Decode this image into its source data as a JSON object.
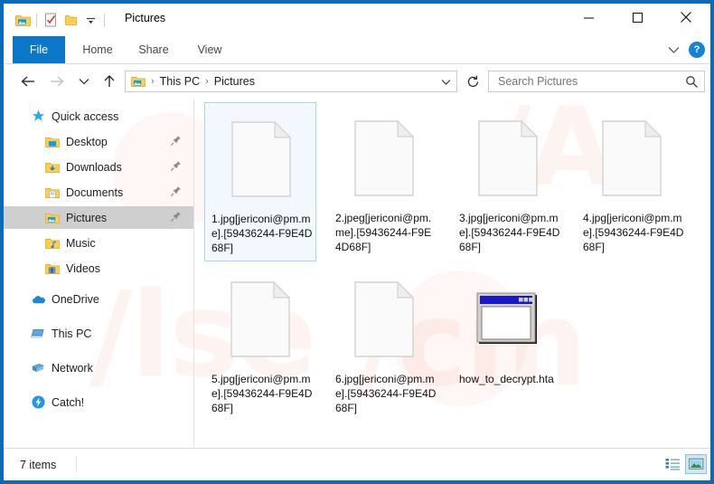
{
  "window": {
    "title": "Pictures",
    "border_color": "#0a6cb8",
    "controls": {
      "minimize": "minimize-icon",
      "maximize": "maximize-icon",
      "close": "close-icon"
    },
    "quick_access_toolbar": [
      {
        "name": "pictures-folder-icon",
        "label": "Pictures"
      },
      {
        "name": "properties-icon",
        "label": "Properties"
      },
      {
        "name": "new-folder-icon",
        "label": "New folder"
      },
      {
        "name": "customize-dropdown-icon",
        "label": "Customize Quick Access Toolbar"
      }
    ]
  },
  "ribbon": {
    "tabs": [
      {
        "label": "File",
        "active": true
      },
      {
        "label": "Home",
        "active": false
      },
      {
        "label": "Share",
        "active": false
      },
      {
        "label": "View",
        "active": false
      }
    ],
    "file_tab_color": "#0c77c8",
    "expand_label": "∨",
    "help_label": "?"
  },
  "address_bar": {
    "back_label": "←",
    "forward_label": "→",
    "recent_label": "∨",
    "up_label": "↑",
    "breadcrumbs": [
      "This PC",
      "Pictures"
    ],
    "separator": "›",
    "dropdown_label": "∨",
    "refresh_label": "↻"
  },
  "search": {
    "placeholder": "Search Pictures",
    "value": "",
    "icon": "search-icon"
  },
  "sidebar": {
    "groups": [
      {
        "header": {
          "label": "Quick access",
          "icon": "star-icon"
        },
        "items": [
          {
            "label": "Desktop",
            "icon": "folder-desktop-icon",
            "pinned": true,
            "selected": false
          },
          {
            "label": "Downloads",
            "icon": "folder-downloads-icon",
            "pinned": true,
            "selected": false
          },
          {
            "label": "Documents",
            "icon": "folder-documents-icon",
            "pinned": true,
            "selected": false
          },
          {
            "label": "Pictures",
            "icon": "folder-pictures-icon",
            "pinned": true,
            "selected": true
          },
          {
            "label": "Music",
            "icon": "folder-music-icon",
            "pinned": false,
            "selected": false
          },
          {
            "label": "Videos",
            "icon": "folder-videos-icon",
            "pinned": false,
            "selected": false
          }
        ]
      },
      {
        "header": null,
        "items": [
          {
            "label": "OneDrive",
            "icon": "onedrive-icon",
            "pinned": false,
            "selected": false
          },
          {
            "label": "This PC",
            "icon": "this-pc-icon",
            "pinned": false,
            "selected": false
          },
          {
            "label": "Network",
            "icon": "network-icon",
            "pinned": false,
            "selected": false
          },
          {
            "label": "Catch!",
            "icon": "catch-icon",
            "pinned": false,
            "selected": false
          }
        ]
      }
    ]
  },
  "files": [
    {
      "name": "1.jpg[jericoni@pm.me].[59436244-F9E4D68F]",
      "icon": "generic-file-icon",
      "selected": true
    },
    {
      "name": "2.jpeg[jericoni@pm.me].[59436244-F9E4D68F]",
      "icon": "generic-file-icon",
      "selected": false
    },
    {
      "name": "3.jpg[jericoni@pm.me].[59436244-F9E4D68F]",
      "icon": "generic-file-icon",
      "selected": false
    },
    {
      "name": "4.jpg[jericoni@pm.me].[59436244-F9E4D68F]",
      "icon": "generic-file-icon",
      "selected": false
    },
    {
      "name": "5.jpg[jericoni@pm.me].[59436244-F9E4D68F]",
      "icon": "generic-file-icon",
      "selected": false
    },
    {
      "name": "6.jpg[jericoni@pm.me].[59436244-F9E4D68F]",
      "icon": "generic-file-icon",
      "selected": false
    },
    {
      "name": "how_to_decrypt.hta",
      "icon": "hta-window-icon",
      "selected": false
    }
  ],
  "status_bar": {
    "item_count": "7 items",
    "views": [
      {
        "name": "details-view-button",
        "active": false
      },
      {
        "name": "large-icons-view-button",
        "active": true
      }
    ]
  }
}
